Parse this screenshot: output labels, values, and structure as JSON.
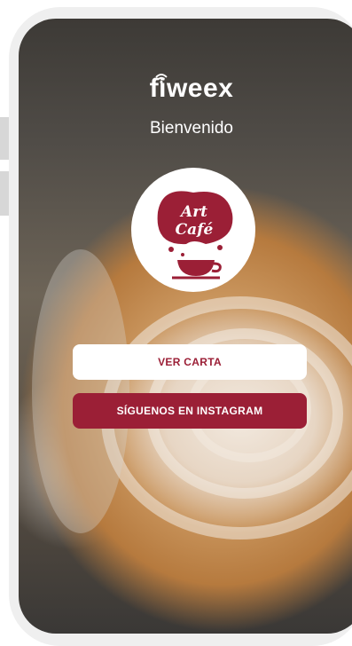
{
  "app": {
    "brand": "fiweex",
    "welcome": "Bienvenido"
  },
  "logo": {
    "text": "Art Café",
    "accent": "#9b1f36"
  },
  "buttons": {
    "menu_label": "VER CARTA",
    "instagram_label": "SÍGUENOS EN INSTAGRAM"
  },
  "icons": [
    "wifi-icon",
    "coffee-cup-icon"
  ],
  "colors": {
    "accent": "#9b1f36",
    "button_light": "#ffffff"
  }
}
